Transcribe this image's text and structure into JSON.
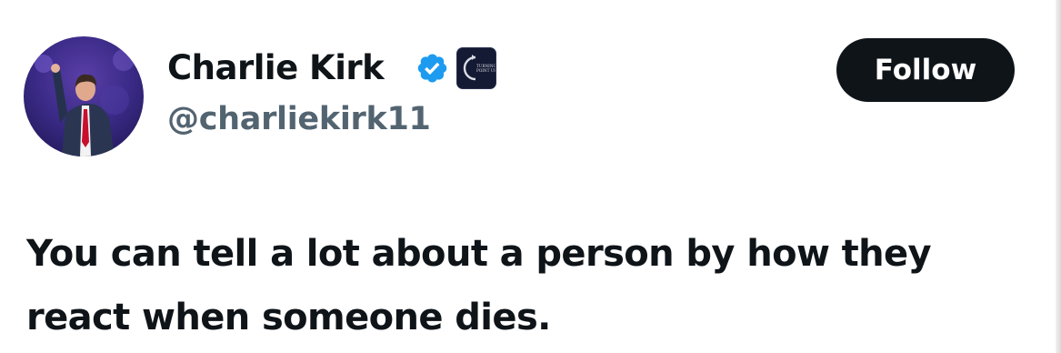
{
  "tweet": {
    "author": {
      "display_name": "Charlie Kirk",
      "handle": "@charliekirk11",
      "verified_icon": "verified-badge-icon",
      "affiliate_icon": "turning-point-usa-logo",
      "affiliate_logo_text": "TURNING POINT USA"
    },
    "follow_label": "Follow",
    "text": "You can tell a lot about a person by how they react when someone dies."
  },
  "colors": {
    "text_primary": "#0f1419",
    "text_secondary": "#536471",
    "verified_blue": "#1d9bf0",
    "button_bg": "#0f1419",
    "button_text": "#ffffff",
    "affiliate_badge_bg": "#141a33"
  }
}
